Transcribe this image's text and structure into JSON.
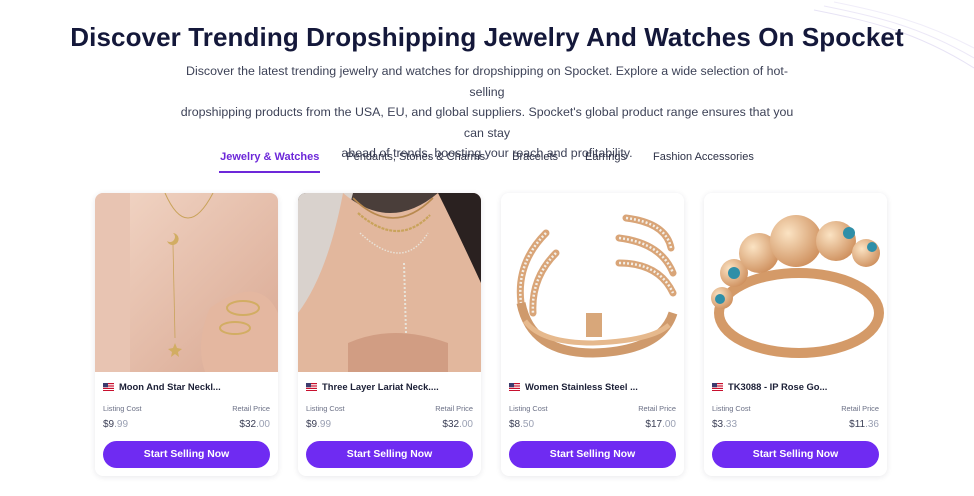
{
  "header": {
    "title": "Discover Trending Dropshipping Jewelry And Watches On Spocket",
    "subtitle_lines": [
      "Discover the latest trending jewelry and watches for dropshipping on Spocket. Explore a wide selection of hot-selling",
      "dropshipping products from the USA, EU, and global suppliers. Spocket's global product range ensures that you can stay",
      "ahead of trends, boosting your reach and profitability."
    ]
  },
  "tabs": [
    {
      "label": "Jewelry & Watches",
      "active": true
    },
    {
      "label": "Pendants, Stones & Charms",
      "active": false
    },
    {
      "label": "Bracelets",
      "active": false
    },
    {
      "label": "Earrings",
      "active": false
    },
    {
      "label": "Fashion Accessories",
      "active": false
    }
  ],
  "colors": {
    "accent": "#6f2bf2",
    "active_tab": "#6d28d9",
    "title": "#14183a"
  },
  "labels": {
    "listing_cost": "Listing Cost",
    "retail_price": "Retail Price",
    "cta": "Start Selling Now"
  },
  "products": [
    {
      "flag": "us-flag-icon",
      "name": "Moon And Star Neckl...",
      "listing_whole": "$9",
      "listing_cents": ".99",
      "retail_whole": "$32",
      "retail_cents": ".00",
      "image": "moon-star-necklace-photo"
    },
    {
      "flag": "us-flag-icon",
      "name": "Three Layer Lariat Neck....",
      "listing_whole": "$9",
      "listing_cents": ".99",
      "retail_whole": "$32",
      "retail_cents": ".00",
      "image": "layered-lariat-necklace-photo"
    },
    {
      "flag": "us-flag-icon",
      "name": "Women Stainless Steel ...",
      "listing_whole": "$8",
      "listing_cents": ".50",
      "retail_whole": "$17",
      "retail_cents": ".00",
      "image": "crystal-wrap-ring-photo"
    },
    {
      "flag": "us-flag-icon",
      "name": "TK3088 - IP Rose Go...",
      "listing_whole": "$3",
      "listing_cents": ".33",
      "retail_whole": "$11",
      "retail_cents": ".36",
      "image": "rose-gold-bead-ring-photo"
    }
  ]
}
